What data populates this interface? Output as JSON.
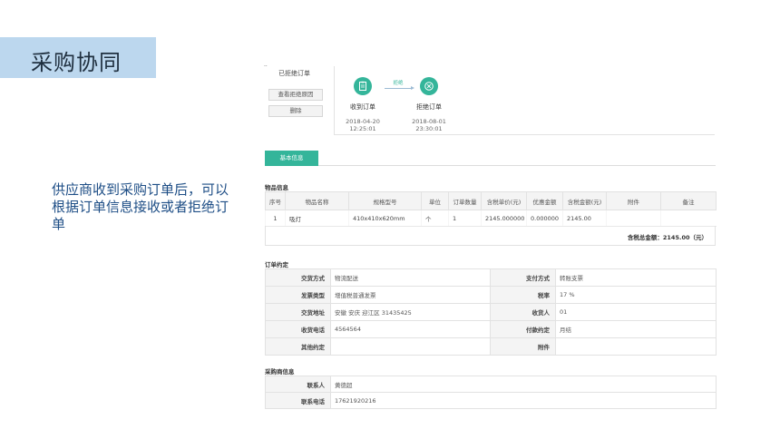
{
  "slide": {
    "title": "采购协同",
    "description": "供应商收到采购订单后，可以根据订单信息接收或者拒绝订单"
  },
  "header": {
    "mark": "..",
    "status": "已拒绝订单"
  },
  "actions": {
    "view_reason": "查看拒绝原因",
    "delete": "删除"
  },
  "flow": {
    "arrow_label": "拒绝",
    "steps": [
      {
        "label": "收到订单",
        "date": "2018-04-20",
        "time": "12:25:01",
        "icon": "clipboard-icon"
      },
      {
        "label": "拒绝订单",
        "date": "2018-08-01",
        "time": "23:30:01",
        "icon": "close-circle-icon"
      }
    ]
  },
  "tabs": {
    "basic": "基本信息"
  },
  "goods": {
    "title": "物品信息",
    "headers": [
      "序号",
      "物品名称",
      "规格型号",
      "单位",
      "订单数量",
      "含税单价(元)",
      "优惠金额",
      "含税金额(元)",
      "附件",
      "备注"
    ],
    "rows": [
      [
        "1",
        "吸灯",
        "410x410x620mm",
        "个",
        "1",
        "2145.000000",
        "0.000000",
        "2145.00",
        "",
        ""
      ]
    ],
    "total": "含税总金额：2145.00（元）"
  },
  "order": {
    "title": "订单约定",
    "rows": [
      {
        "k1": "交货方式",
        "v1": "物流配送",
        "k2": "支付方式",
        "v2": "转账支票"
      },
      {
        "k1": "发票类型",
        "v1": "增值税普通发票",
        "k2": "税率",
        "v2": "17 %"
      },
      {
        "k1": "交货地址",
        "v1": "安徽 安庆 迎江区 31435425",
        "k2": "收货人",
        "v2": "01"
      },
      {
        "k1": "收货电话",
        "v1": "4564564",
        "k2": "付款约定",
        "v2": "月结"
      },
      {
        "k1": "其他约定",
        "v1": "",
        "k2": "附件",
        "v2": ""
      }
    ]
  },
  "buyer": {
    "title": "采购商信息",
    "contact_label": "联系人",
    "contact_value": "黄徳超",
    "phone_label": "联系电话",
    "phone_value": "17621920216"
  },
  "colors": {
    "accent": "#34b59a",
    "title_bg": "#bcd7ee",
    "desc_text": "#1e4e86"
  }
}
